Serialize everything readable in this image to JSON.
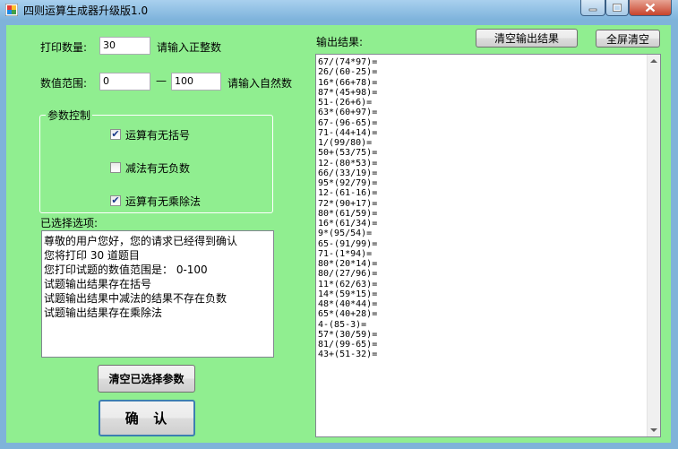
{
  "window": {
    "title": "四则运算生成器升级版1.0"
  },
  "form": {
    "print_count_label": "打印数量:",
    "print_count_value": "30",
    "print_count_hint": "请输入正整数",
    "range_label": "数值范围:",
    "range_min_value": "0",
    "range_dash": "—",
    "range_max_value": "100",
    "range_hint": "请输入自然数",
    "params_group_title": "参数控制",
    "params": [
      {
        "label": "运算有无括号",
        "checked": true
      },
      {
        "label": "减法有无负数",
        "checked": false
      },
      {
        "label": "运算有无乘除法",
        "checked": true
      }
    ],
    "selected_label": "已选择选项:",
    "selected_lines": [
      "尊敬的用户您好，您的请求已经得到确认",
      "您将打印 30 道题目",
      "您打印试题的数值范围是： 0-100",
      "试题输出结果存在括号",
      "试题输出结果中减法的结果不存在负数",
      "试题输出结果存在乘除法"
    ],
    "clear_params_button": "清空已选择参数",
    "confirm_button": "确  认"
  },
  "output": {
    "label": "输出结果:",
    "clear_output_button": "清空输出结果",
    "clear_all_button": "全屏清空",
    "lines": [
      "67/(74*97)=",
      "26/(60-25)=",
      "16*(66+78)=",
      "87*(45+98)=",
      "51-(26+6)=",
      "63*(60+97)=",
      "67-(96-65)=",
      "71-(44+14)=",
      "1/(99/80)=",
      "50+(53/75)=",
      "12-(80*53)=",
      "66/(33/19)=",
      "95*(92/79)=",
      "12-(61-16)=",
      "72*(90+17)=",
      "80*(61/59)=",
      "16*(61/34)=",
      "9*(95/54)=",
      "65-(91/99)=",
      "71-(1*94)=",
      "80*(20*14)=",
      "80/(27/96)=",
      "11*(62/63)=",
      "14*(59*15)=",
      "48*(40*44)=",
      "65*(40+28)=",
      "4-(85-3)=",
      "57*(30/59)=",
      "81/(99-65)=",
      "43+(51-32)="
    ]
  },
  "icons": {
    "app": "app-icon",
    "minimize": "minimize-icon",
    "maximize": "maximize-icon",
    "close": "close-icon",
    "check": "checkmark-icon",
    "scroll_up": "scroll-up-arrow-icon",
    "scroll_down": "scroll-down-arrow-icon"
  },
  "colors": {
    "client_background": "#90ee90",
    "titlebar": "#8cbde3",
    "close_button": "#c7432c"
  }
}
